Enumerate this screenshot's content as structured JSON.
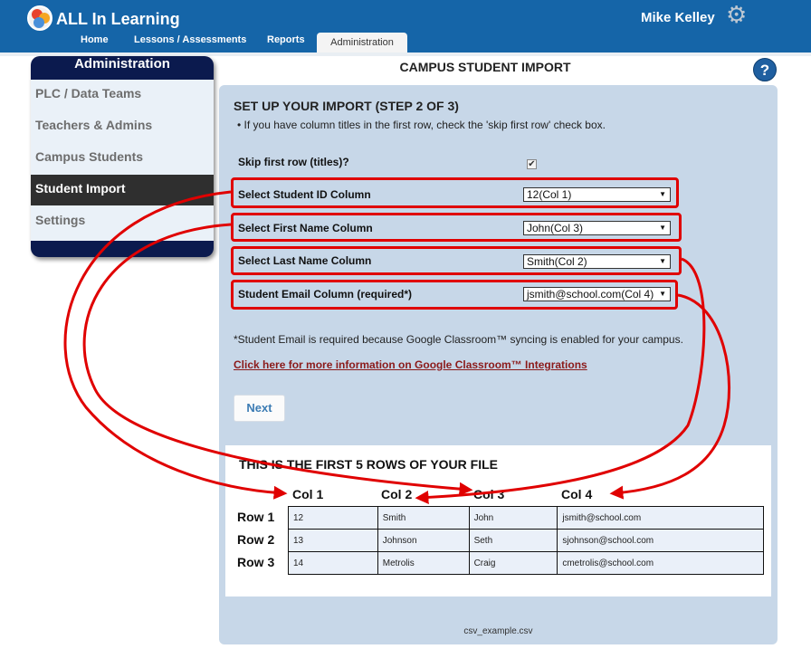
{
  "header": {
    "brand": "ALL In Learning",
    "user_name": "Mike Kelley",
    "nav": [
      "Home",
      "Lessons / Assessments",
      "Reports",
      "Administration"
    ]
  },
  "sidebar": {
    "title": "Administration",
    "items": [
      {
        "label": "PLC / Data Teams",
        "active": false
      },
      {
        "label": "Teachers & Admins",
        "active": false
      },
      {
        "label": "Campus Students",
        "active": false
      },
      {
        "label": "Student Import",
        "active": true
      },
      {
        "label": "Settings",
        "active": false
      }
    ]
  },
  "main": {
    "page_title": "CAMPUS STUDENT IMPORT",
    "help": "?",
    "step_title": "SET UP YOUR IMPORT (STEP 2 OF 3)",
    "instruction": "If you have column titles in the first row, check the 'skip first row' check box.",
    "skip_label": "Skip first row (titles)?",
    "skip_checked": true,
    "fields": [
      {
        "label": "Select Student ID Column",
        "value": "12(Col 1)"
      },
      {
        "label": "Select First Name Column",
        "value": "John(Col 3)"
      },
      {
        "label": "Select Last Name Column",
        "value": "Smith(Col 2)"
      },
      {
        "label": "Student Email Column (required*)",
        "value": "jsmith@school.com(Col 4)"
      }
    ],
    "note": "*Student Email is required because Google Classroom™ syncing is enabled for your campus.",
    "link": "Click here for more information on Google Classroom™ Integrations",
    "next_label": "Next"
  },
  "preview": {
    "title": "THIS IS THE FIRST 5 ROWS OF YOUR FILE",
    "columns": [
      "Col 1",
      "Col 2",
      "Col 3",
      "Col 4"
    ],
    "row_labels": [
      "Row 1",
      "Row 2",
      "Row 3"
    ],
    "rows": [
      [
        "12",
        "Smith",
        "John",
        "jsmith@school.com"
      ],
      [
        "13",
        "Johnson",
        "Seth",
        "sjohnson@school.com"
      ],
      [
        "14",
        "Metrolis",
        "Craig",
        "cmetrolis@school.com"
      ]
    ],
    "filename": "csv_example.csv"
  },
  "colors": {
    "header_blue": "#1565a8",
    "sidebar_navy": "#0b1a4e",
    "panel": "#c7d7e8",
    "annotation_red": "#e00000"
  }
}
